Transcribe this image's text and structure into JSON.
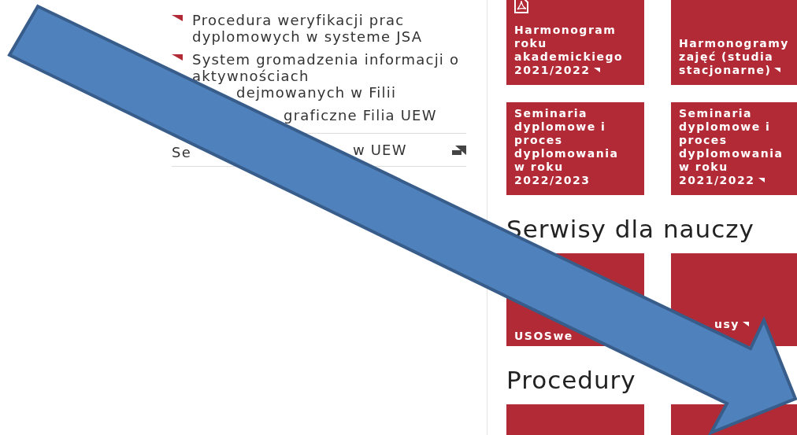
{
  "sidebar": {
    "items": [
      {
        "kind": "bullet",
        "text": "Procedura weryfikacji prac dyplomowych w systeme JSA"
      },
      {
        "kind": "bullet",
        "text": "System gromadzenia informacji o aktywnościach",
        "continuation": "dejmowanych w Filii"
      },
      {
        "kind": "fragment",
        "text": "graficzne Filia UEW"
      }
    ],
    "service_link": {
      "left": "Se",
      "right": "w UEW"
    }
  },
  "sections": [
    {
      "tiles": [
        {
          "text": "Harmonogram roku akademickiego 2021/2022",
          "link_mark": true
        },
        {
          "text": "Harmonogramy zajęć (studia stacjonarne)",
          "link_mark": true
        },
        {
          "text": "Seminaria dyplomowe i proces dyplomowania w roku 2022/2023",
          "link_mark": false
        },
        {
          "text": "Seminaria dyplomowe i proces dyplomowania w roku 2021/2022",
          "link_mark": true
        }
      ]
    },
    {
      "heading": "Serwisy dla nauczy",
      "tiles": [
        {
          "text": "USOSwe"
        },
        {
          "text": "usy",
          "link_mark": true
        }
      ]
    },
    {
      "heading": "Procedury",
      "tiles": [
        {
          "kind": "plain"
        },
        {
          "kind": "plain"
        }
      ]
    }
  ]
}
